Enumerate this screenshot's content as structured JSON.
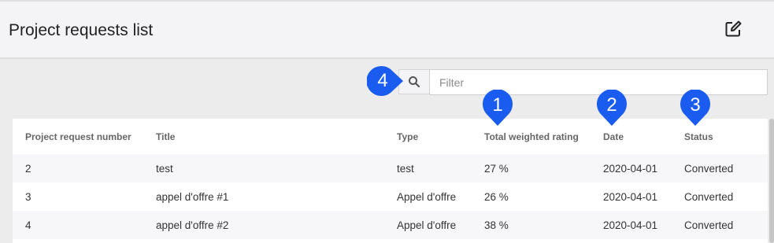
{
  "header": {
    "title": "Project requests list",
    "edit_icon": "edit-square-icon"
  },
  "search": {
    "icon": "search-icon",
    "placeholder": "Filter",
    "value": ""
  },
  "table": {
    "columns": [
      "Project request number",
      "Title",
      "Type",
      "Total weighted rating",
      "Date",
      "Status"
    ],
    "rows": [
      [
        "2",
        "test",
        "test",
        "27 %",
        "2020-04-01",
        "Converted"
      ],
      [
        "3",
        "appel d'offre #1",
        "Appel d'offre",
        "26 %",
        "2020-04-01",
        "Converted"
      ],
      [
        "4",
        "appel d'offre #2",
        "Appel d'offre",
        "38 %",
        "2020-04-01",
        "Converted"
      ]
    ]
  },
  "markers": [
    "1",
    "2",
    "3",
    "4"
  ],
  "colors": {
    "marker": "#1a5cf0",
    "header_bg": "#f4f4f6",
    "page_bg": "#ececec"
  }
}
